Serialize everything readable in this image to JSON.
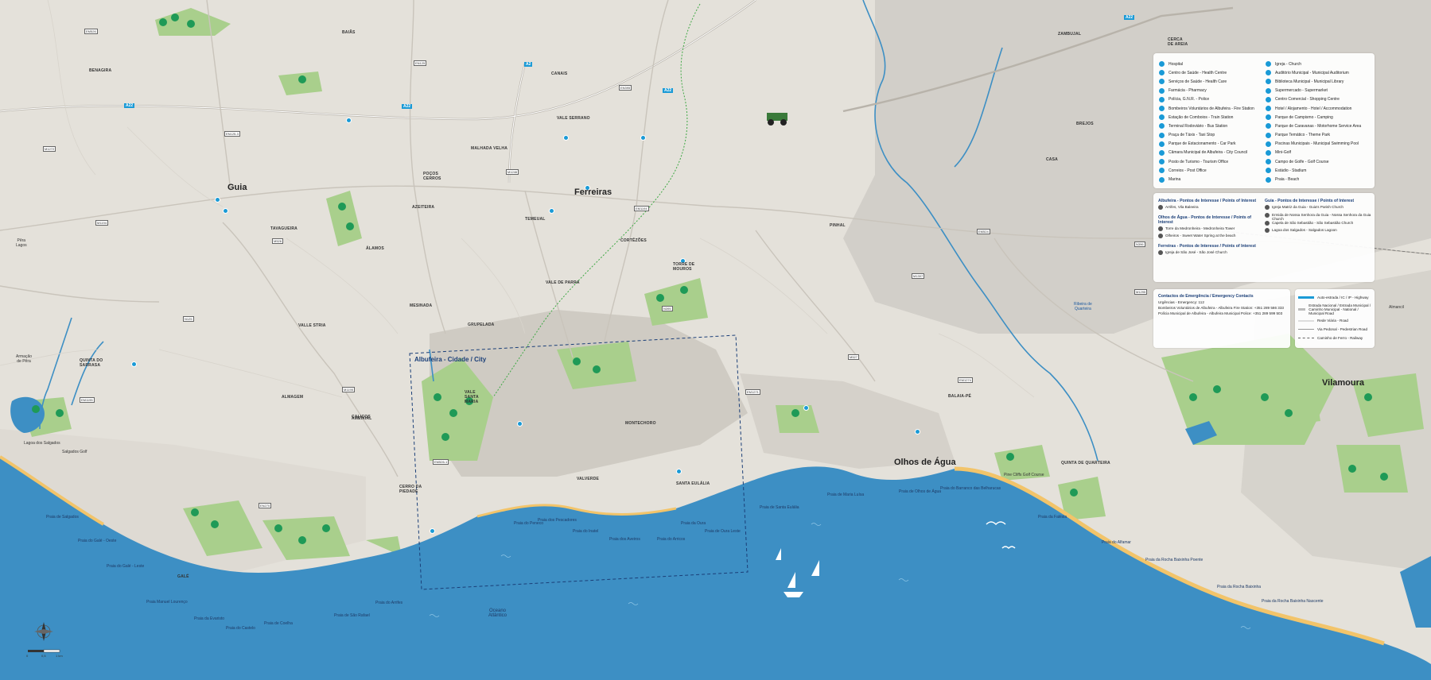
{
  "map": {
    "colors": {
      "sea": "#3d8fc4",
      "land": "#e4e1da",
      "urban": "#cfcbc3",
      "park": "#a9cf8c",
      "tree": "#1f9a57",
      "beach": "#f2c46a",
      "accent": "#1a9ad6",
      "trail": "#3fa845"
    },
    "towns_major": [
      "Guia",
      "Ferreiras",
      "Olhos de Água",
      "Vilamoura"
    ],
    "towns_minor": [
      "Algoz",
      "Baiãs",
      "Algoz",
      "Tunes",
      "Tunes\nLisboa",
      "Paderne",
      "Faro\nMessines\nLisboa",
      "Paderne",
      "Albufeira\nMessines\nLisboa",
      "Zambujal",
      "Cerca\nde Areia",
      "Faro\nLoulé\nEspanha",
      "Benagira",
      "Canais",
      "Vale Serrano",
      "Malhada Velha",
      "Poços\nCerros",
      "Azeiteira",
      "Tavagueira",
      "Álamos",
      "Temeual",
      "Cortêzões",
      "Torre de\nMouros",
      "Vale de Parra",
      "Açoteias",
      "Pinhal",
      "Brejos",
      "Casa",
      "Valle Stria",
      "Grupelada",
      "Almagem",
      "Ameixial",
      "Mesinada",
      "Caliços",
      "Vale\nSanta\nMaria",
      "Quinta do\nSarrasa",
      "Cerro da\nPiedade",
      "Torre Guerra",
      "Cabeça",
      "Galé",
      "Valverde",
      "Santa Eulália",
      "Balaia-Pé",
      "Montechoro",
      "Quinta de Quarteira"
    ],
    "city_box_title": "Albufeira - Cidade / City",
    "destinations": [
      "Pêra\nLagos",
      "Armação\nde Pêra",
      "Almancil"
    ],
    "beaches": [
      "Praia de Salgados",
      "Praia do Galé - Oeste",
      "Praia do Galé - Leste",
      "Praia Manuel Lourenço",
      "Praia da Evaristo",
      "Praia do Castelo",
      "Praia de Coelha",
      "Praia de São Rafael",
      "Praia do Arrifes",
      "Praia do Peneco",
      "Praia dos Pescadores",
      "Praia do Inatel",
      "Praia dos Aveiros",
      "Praia do Arricos",
      "Praia da Oura",
      "Praia de Oura Leste",
      "Praia de Santa Eulália",
      "Praia de Maria Luísa",
      "Praia de Olhos de Água",
      "Praia do Barranco das Belharucas",
      "Praia da Falésia",
      "Praia do Alfamar",
      "Praia da Rocha Baixinha Poente",
      "Praia da Rocha Baixinha",
      "Praia da Rocha Baixinha Nascente"
    ],
    "ocean_label": "Oceano\nAtlântico",
    "river_label": "Ribeira de\nQuarteira",
    "parks": [
      "Lagoa dos Salgados",
      "Salgados Golf",
      "Campo de Golfe de Salgados",
      "Parque de Campismo de Albufeira",
      "Pine Cliffs Golf Course",
      "Vale do Lobo"
    ],
    "highways": [
      "A22",
      "A22",
      "A2",
      "A22",
      "A22"
    ],
    "road_codes": [
      "EM526",
      "EN125",
      "M1272",
      "EN125-3",
      "EN395",
      "M1194",
      "M526",
      "EM1194",
      "M1246",
      "N395",
      "EM524",
      "N125",
      "M1195",
      "EM1195",
      "M527",
      "EM526-1",
      "EN270",
      "EM1271",
      "M1307",
      "N396",
      "M1295",
      "EM1274"
    ],
    "scale_labels": [
      "0",
      "0,5",
      "1 km"
    ]
  },
  "legend": {
    "col1": [
      "Hospital",
      "Centro de Saúde - Health Centre",
      "Serviços de Saúde - Health Care",
      "Farmácia - Pharmacy",
      "Polícia, G.N.R. - Police",
      "Bombeiros Voluntários de Albufeira - Fire Station",
      "Estação de Comboios - Train Station",
      "Terminal Rodoviário - Bus Station",
      "Praça de Táxis - Taxi Stop",
      "Parque de Estacionamento - Car Park",
      "Câmara Municipal de Albufeira - City Council",
      "Posto de Turismo - Tourism Office",
      "Correios - Post Office",
      "Marina"
    ],
    "col2": [
      "Igreja - Church",
      "Auditório Municipal - Municipal Auditorium",
      "Biblioteca Municipal - Municipal Library",
      "Supermercado - Supermarket",
      "Centro Comercial - Shopping Centre",
      "Hotel / Alojamento - Hotel / Accommodation",
      "Parque de Campismo - Camping",
      "Parque de Caravanas - Motorhome Service Area",
      "Parque Temático - Theme Park",
      "Piscinas Municipais - Municipal Swimming Pool",
      "Mini-Golf",
      "Campo de Golfe - Golf Course",
      "Estádio - Stadium",
      "Praia - Beach"
    ]
  },
  "poi": {
    "albufeira_head": "Albufeira - Pontos de Interesse / Points of Interest",
    "albufeira_items": [
      "Arrifes, Vila Baleeira"
    ],
    "olhos_head": "Olhos de Água - Pontos de Interesse / Points of Interest",
    "olhos_items": [
      "Torre da Medronheira - Medronheira Tower",
      "Olheiros - Sweet Water Spring at the beach"
    ],
    "ferreiras_head": "Ferreiras - Pontos de Interesse / Points of Interest",
    "ferreiras_items": [
      "Igreja de São José - São José Church"
    ],
    "guia_head": "Guia - Pontos de Interesse / Points of Interest",
    "guia_items": [
      "Igreja Matriz da Guia - Guia's Parish Church",
      "Ermida de Nossa Senhora da Guia - Nossa Senhora da Guia Church",
      "Capela de São Sebastião - São Sebastião Church",
      "Lagoa dos Salgados - Salgados Lagoon"
    ]
  },
  "contacts": {
    "head": "Contactos de Emergência / Emergency Contacts",
    "lines": [
      "Urgências - Emergency: 112",
      "Bombeiros Voluntários de Albufeira - Albufeira Fire Station: +351 289 586 333",
      "Polícia Municipal de Albufeira - Albufeira Municipal Police: +351 289 599 503"
    ]
  },
  "key": {
    "items": [
      "Auto-estrada / IC / IP - Highway",
      "Estrada Nacional / Estrada Municipal / Caminho Municipal - National / Municipal Road",
      "Rede Viária - Road",
      "Via Pedonal - Pedestrian Road",
      "Caminho de Ferro - Railway"
    ]
  }
}
